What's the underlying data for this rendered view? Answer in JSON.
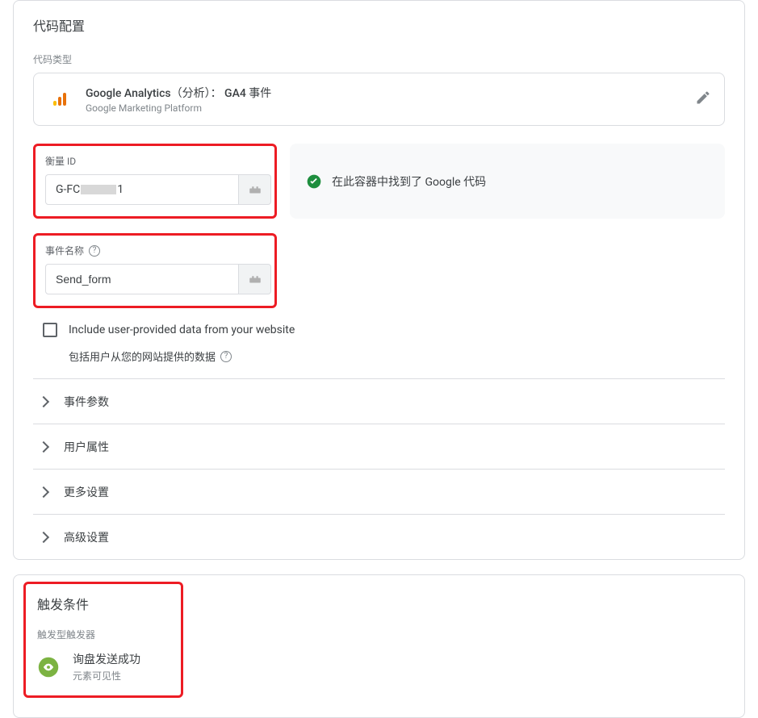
{
  "config": {
    "title": "代码配置",
    "type_label": "代码类型",
    "type_title": "Google Analytics（分析）： GA4 事件",
    "type_subtitle": "Google Marketing Platform",
    "measurement_label": "衡量 ID",
    "measurement_prefix": "G-FC",
    "measurement_suffix": "1",
    "status_text": "在此容器中找到了 Google 代码",
    "event_label": "事件名称",
    "event_value": "Send_form",
    "include_label": "Include user-provided data from your website",
    "include_caption": "包括用户从您的网站提供的数据",
    "accordion": [
      "事件参数",
      "用户属性",
      "更多设置",
      "高级设置"
    ]
  },
  "trigger": {
    "title": "触发条件",
    "sub_label": "触发型触发器",
    "item_title": "询盘发送成功",
    "item_subtitle": "元素可见性"
  }
}
